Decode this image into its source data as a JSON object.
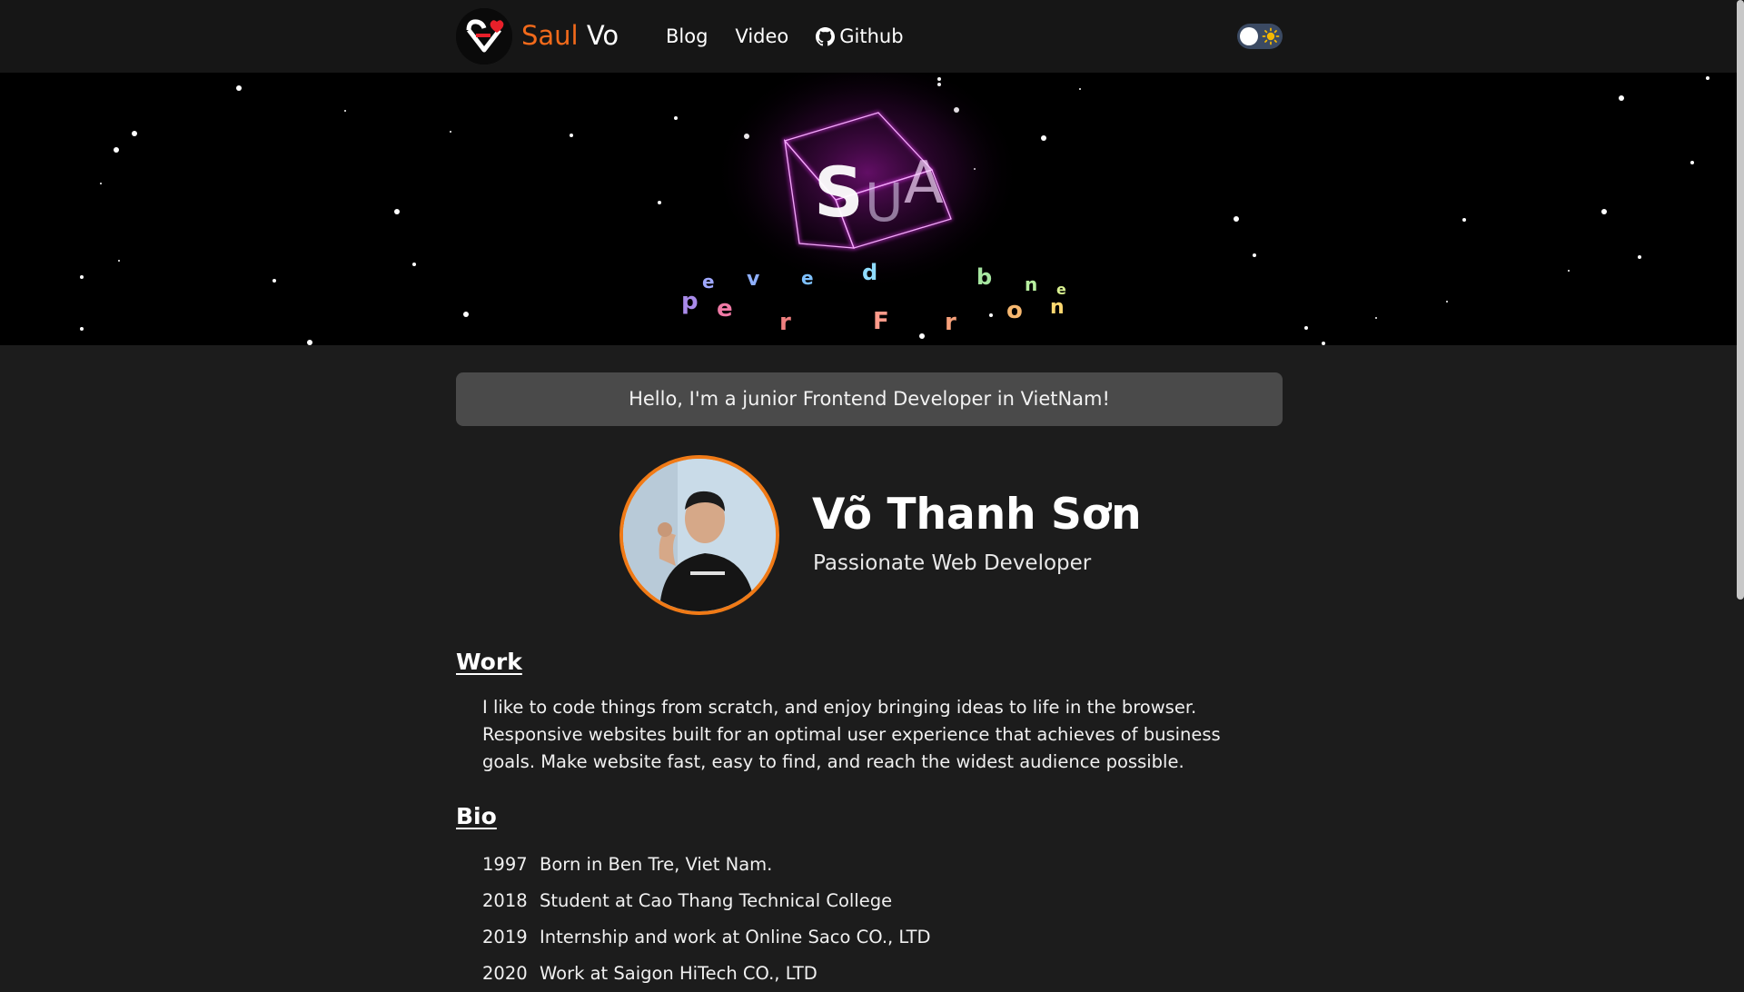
{
  "header": {
    "brand_first": "Saul",
    "brand_second": " Vo",
    "nav": [
      {
        "label": "Blog"
      },
      {
        "label": "Video"
      },
      {
        "label": "Github",
        "icon": "github-icon"
      }
    ],
    "theme_toggle_icon": "sun-icon"
  },
  "banner": {
    "cube_letters": "SUA",
    "ring_text": "developer Frontend"
  },
  "intro": {
    "greeting": "Hello, I'm a junior Frontend Developer in VietNam!"
  },
  "profile": {
    "name": "Võ Thanh Sơn",
    "title": "Passionate Web Developer",
    "accent_color": "#f07a16"
  },
  "work": {
    "heading": "Work",
    "text": "I like to code things from scratch, and enjoy bringing ideas to life in the browser. Responsive websites built for an optimal user experience that achieves of business goals. Make website fast, easy to find, and reach the widest audience possible."
  },
  "bio": {
    "heading": "Bio",
    "items": [
      {
        "year": "1997",
        "text": "Born in Ben Tre, Viet Nam."
      },
      {
        "year": "2018",
        "text": "Student at Cao Thang Technical College"
      },
      {
        "year": "2019",
        "text": "Internship and work at Online Saco CO., LTD"
      },
      {
        "year": "2020",
        "text": "Work at Saigon HiTech CO., LTD"
      }
    ]
  },
  "colors": {
    "brand_orange": "#f26a1b",
    "background": "#1c1c1c",
    "header_bg": "#161616",
    "greeting_bg": "#4a4a4a",
    "cube_glow": "#d020e0"
  }
}
